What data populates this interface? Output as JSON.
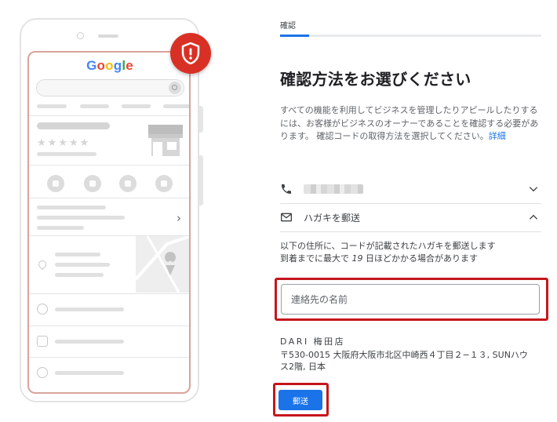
{
  "illustration": {
    "logo_text": {
      "l1": "G",
      "l2": "o",
      "l3": "o",
      "l4": "g",
      "l5": "l",
      "l6": "e"
    },
    "stars": "★★★★★",
    "chevron": "›",
    "badge_color": "#d93025"
  },
  "panel": {
    "step_label": "確認",
    "progress": 0.11,
    "title": "確認方法をお選びください",
    "description": "すべての機能を利用してビジネスを管理したりアピールしたりするには、お客様がビジネスのオーナーであることを確認する必要があります。 確認コードの取得方法を選択してください。",
    "description_link": "詳細",
    "options": {
      "phone": {
        "icon": "phone-icon",
        "expanded": false
      },
      "postcard": {
        "icon": "mail-icon",
        "label": "ハガキを郵送",
        "expanded": true
      }
    },
    "postcard_info": {
      "line1": "以下の住所に、コードが記載されたハガキを郵送します",
      "line2_prefix": "到着までに最大で ",
      "line2_days": "19",
      "line2_suffix": " 日ほどかかる場合があります"
    },
    "contact_name": {
      "placeholder": "連絡先の名前",
      "value": ""
    },
    "address": {
      "business": "DARI 梅田店",
      "line1": "〒530-0015 大阪府大阪市北区中崎西４丁目２−１３, SUNハウ",
      "line2": "ス2階, 日本"
    },
    "send_button": "郵送",
    "accent_color": "#1a73e8",
    "highlight_color": "#c5161d"
  }
}
